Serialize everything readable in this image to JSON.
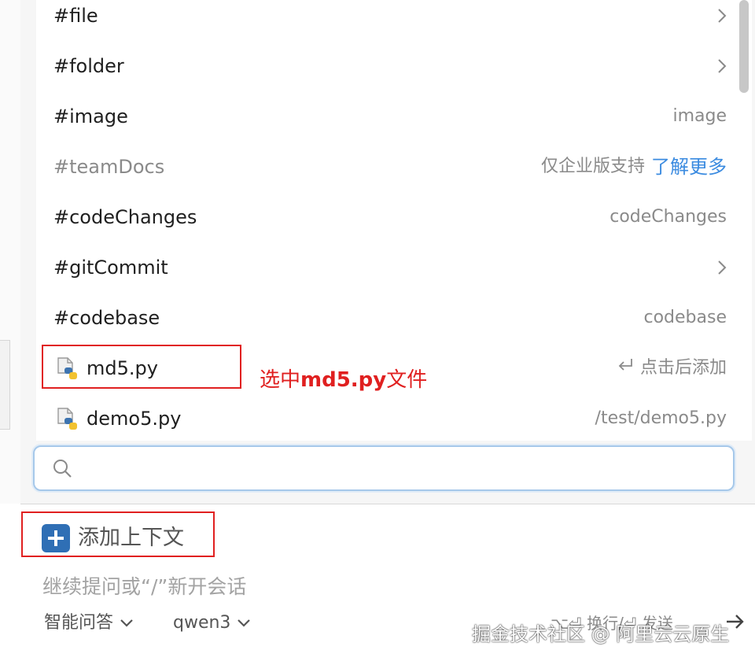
{
  "context_menu": {
    "items": [
      {
        "label": "#file",
        "right": ""
      },
      {
        "label": "#folder",
        "right": ""
      },
      {
        "label": "#image",
        "right": "image"
      },
      {
        "label": "#teamDocs",
        "right": "仅企业版支持",
        "link": "了解更多"
      },
      {
        "label": "#codeChanges",
        "right": "codeChanges"
      },
      {
        "label": "#gitCommit",
        "right": ""
      },
      {
        "label": "#codebase",
        "right": "codebase"
      },
      {
        "label": "md5.py",
        "right": "点击后添加"
      },
      {
        "label": "demo5.py",
        "right": "/test/demo5.py"
      }
    ],
    "search": {
      "value": "",
      "placeholder": ""
    }
  },
  "annotation": {
    "prefix": "选中",
    "bold": "md5.py",
    "suffix": "文件"
  },
  "composer": {
    "add_context_label": "添加上下文",
    "input_placeholder": "继续提问或“/”新开会话",
    "mode_label": "智能问答",
    "model_label": "qwen3",
    "hint": "⌥⏎ 换行/⏎ 发送"
  },
  "watermark": "掘金技术社区 @ 阿里云云原生",
  "colors": {
    "highlight_red": "#e02020",
    "link_blue": "#3b8be0",
    "plus_button_blue": "#2f6fb5",
    "search_border": "#a6c8ea"
  },
  "icons": {
    "chevron": "chevron-right-icon",
    "python_file": "python-file-icon",
    "search": "search-icon",
    "enter": "enter-icon",
    "plus": "plus-icon"
  }
}
